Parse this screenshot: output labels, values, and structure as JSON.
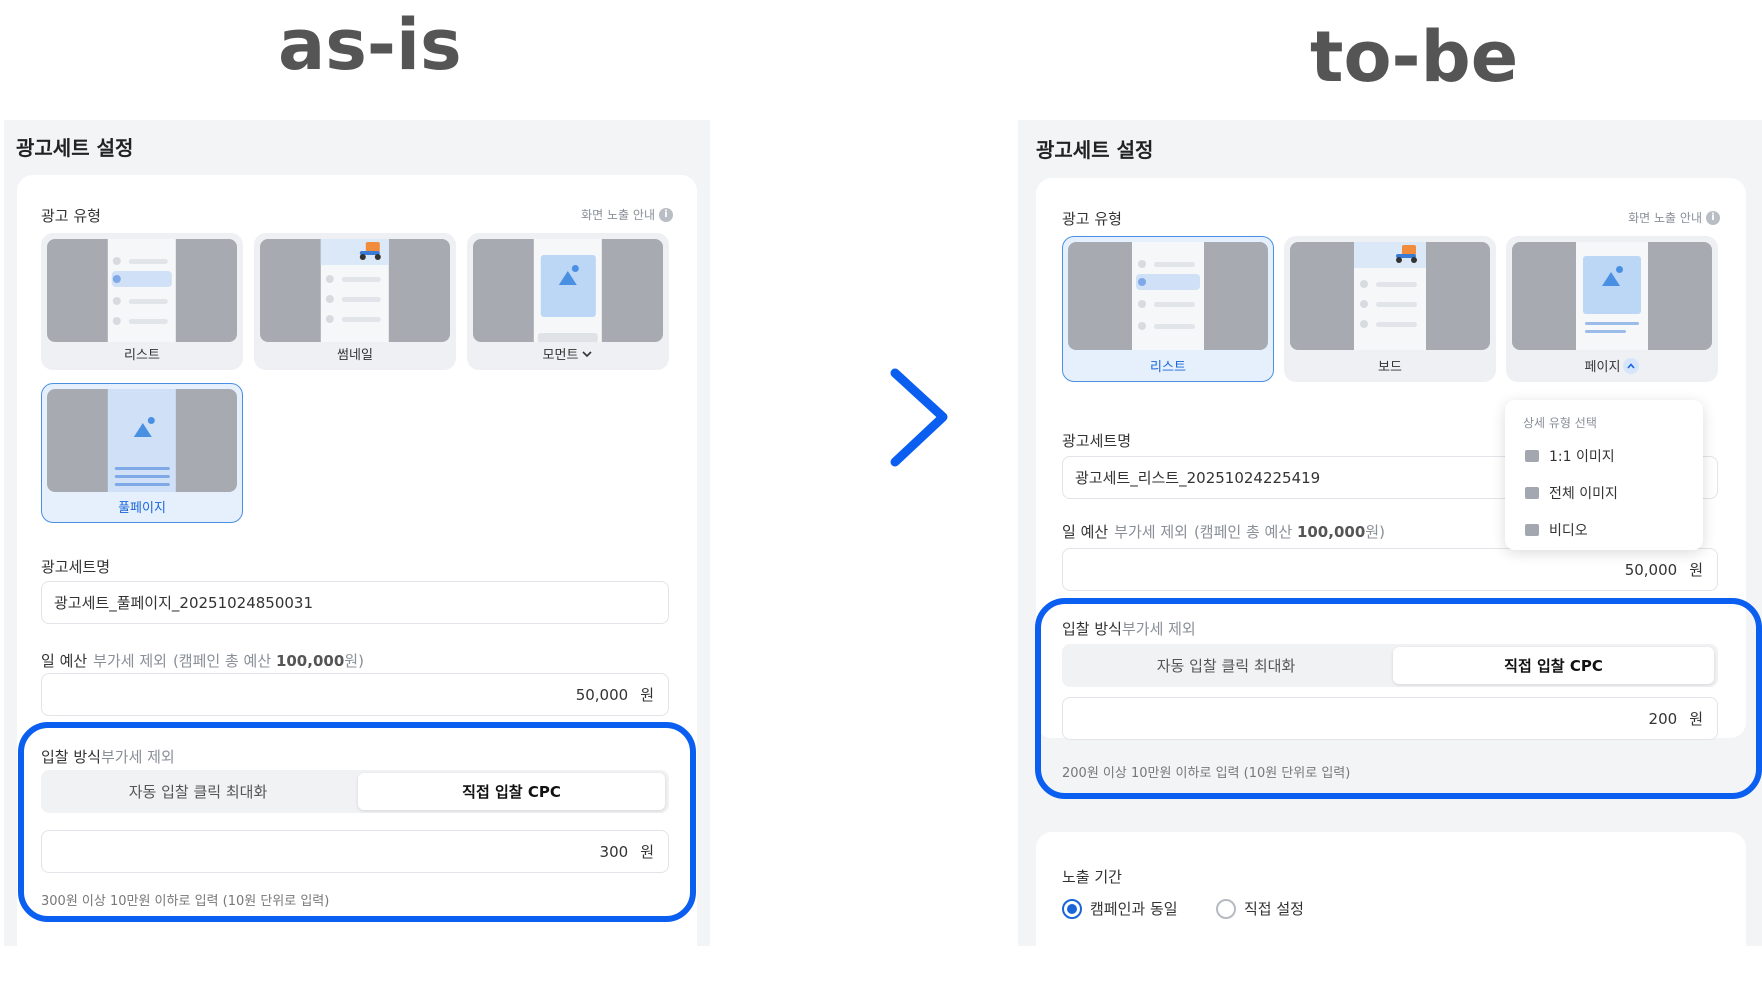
{
  "headings": {
    "as_is": "as-is",
    "to_be": "to-be"
  },
  "as_is": {
    "panel_title": "광고세트 설정",
    "ad_type": {
      "label": "광고 유형",
      "help": "화면 노출 안내",
      "options": [
        "리스트",
        "썸네일",
        "모먼트",
        "풀페이지"
      ],
      "selected": "풀페이지"
    },
    "adset_name": {
      "label": "광고세트명",
      "value": "광고세트_풀페이지_20251024850031"
    },
    "daily_budget": {
      "label": "일 예산",
      "sub": "부가세 제외",
      "campaign_prefix": "(캠페인 총 예산",
      "campaign_amount": "100,000",
      "campaign_suffix": "원)",
      "value": "50,000",
      "unit": "원"
    },
    "bidding": {
      "label": "입찰 방식",
      "sub": "부가세 제외",
      "options": [
        "자동 입찰 클릭 최대화",
        "직접 입찰 CPC"
      ],
      "selected": "직접 입찰 CPC",
      "value": "300",
      "unit": "원",
      "hint": "300원 이상 10만원 이하로 입력 (10원 단위로 입력)"
    }
  },
  "to_be": {
    "panel_title": "광고세트 설정",
    "ad_type": {
      "label": "광고 유형",
      "help": "화면 노출 안내",
      "options": [
        "리스트",
        "보드",
        "페이지"
      ],
      "selected": "리스트"
    },
    "dropdown": {
      "title": "상세 유형 선택",
      "items": [
        "1:1 이미지",
        "전체 이미지",
        "비디오"
      ]
    },
    "adset_name": {
      "label": "광고세트명",
      "value": "광고세트_리스트_20251024225419"
    },
    "daily_budget": {
      "label": "일 예산",
      "sub": "부가세 제외",
      "campaign_prefix": "(캠페인 총 예산",
      "campaign_amount": "100,000",
      "campaign_suffix": "원)",
      "value": "50,000",
      "unit": "원"
    },
    "bidding": {
      "label": "입찰 방식",
      "sub": "부가세 제외",
      "options": [
        "자동 입찰 클릭 최대화",
        "직접 입찰 CPC"
      ],
      "selected": "직접 입찰 CPC",
      "value": "200",
      "unit": "원",
      "hint": "200원 이상 10만원 이하로 입력 (10원 단위로 입력)"
    },
    "exposure_period": {
      "label": "노출 기간",
      "options": [
        "캠페인과 동일",
        "직접 설정"
      ],
      "selected": "캠페인과 동일"
    }
  },
  "colors": {
    "highlight": "#0a5ef0",
    "accent": "#1a66d9",
    "panel_bg": "#f3f4f6"
  }
}
